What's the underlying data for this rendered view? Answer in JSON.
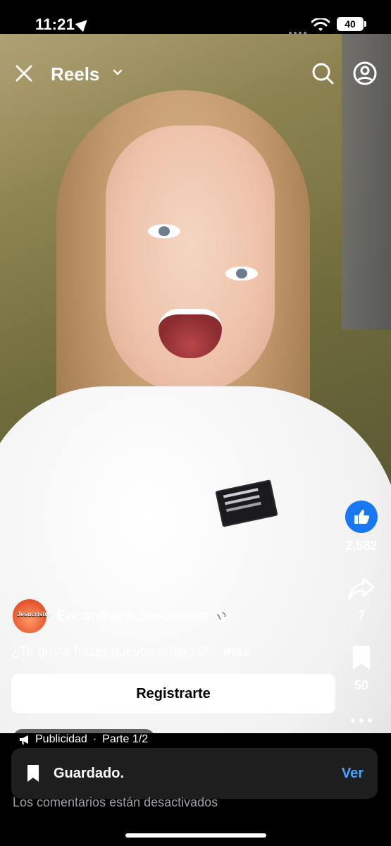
{
  "status_bar": {
    "time": "11:21",
    "battery": "40"
  },
  "topbar": {
    "title": "Reels",
    "icons": [
      "close-icon",
      "chevron-down-icon",
      "search-icon",
      "profile-icon"
    ]
  },
  "rail": {
    "likes": "2,582",
    "shares": "7",
    "saves": "50"
  },
  "author": {
    "name": "Encontrar a Jesucristo"
  },
  "caption": {
    "text": "¿Te gusta hacer nuevos amigos?...",
    "more": "más"
  },
  "cta": {
    "label": "Registrarte"
  },
  "ad": {
    "label": "Publicidad",
    "separator": "·",
    "part": "Parte 1/2"
  },
  "toast": {
    "message": "Guardado.",
    "action": "Ver"
  },
  "comments": {
    "status": "Los comentarios están desactivados"
  },
  "colors": {
    "like_blue": "#1877f2",
    "link_blue": "#4aa3ff"
  }
}
